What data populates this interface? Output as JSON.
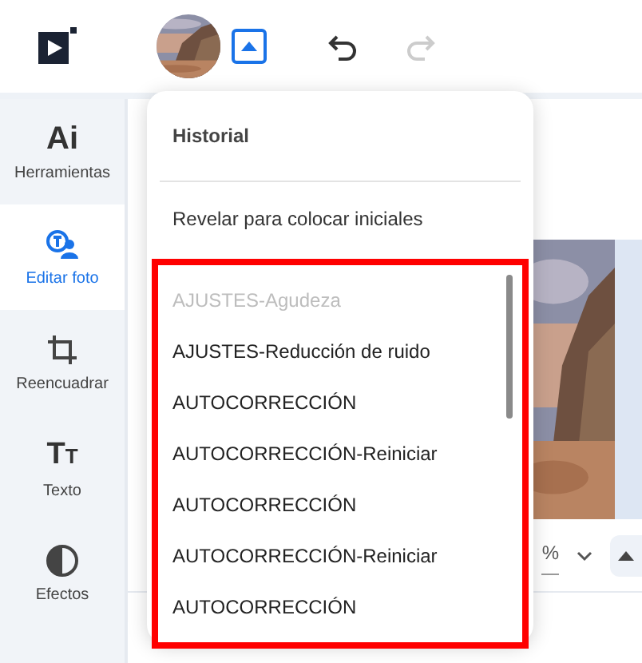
{
  "top_bar": {
    "history_toggle": {
      "expanded": true
    },
    "undo": {
      "disabled": false
    },
    "redo": {
      "disabled": true
    }
  },
  "sidebar": {
    "items": [
      {
        "kind": "ai",
        "icon_text": "Ai",
        "label": "Herramientas",
        "selected": false
      },
      {
        "kind": "edit",
        "label": "Editar foto",
        "selected": true
      },
      {
        "kind": "crop",
        "label": "Reencuadrar",
        "selected": false
      },
      {
        "kind": "text",
        "icon_text": "TT",
        "label": "Texto",
        "selected": false
      },
      {
        "kind": "effects",
        "label": "Efectos",
        "selected": false
      }
    ]
  },
  "zoom_bar": {
    "value": "%"
  },
  "history_menu": {
    "title": "Historial",
    "action": "Revelar para colocar iniciales",
    "highlighted": true,
    "entries": [
      {
        "label": "AJUSTES-Agudeza",
        "disabled": true
      },
      {
        "label": "AJUSTES-Reducción de ruido",
        "disabled": false
      },
      {
        "label": "AUTOCORRECCIÓN",
        "disabled": false
      },
      {
        "label": "AUTOCORRECCIÓN-Reiniciar",
        "disabled": false
      },
      {
        "label": "AUTOCORRECCIÓN",
        "disabled": false
      },
      {
        "label": "AUTOCORRECCIÓN-Reiniciar",
        "disabled": false
      },
      {
        "label": "AUTOCORRECCIÓN",
        "disabled": false
      }
    ]
  }
}
